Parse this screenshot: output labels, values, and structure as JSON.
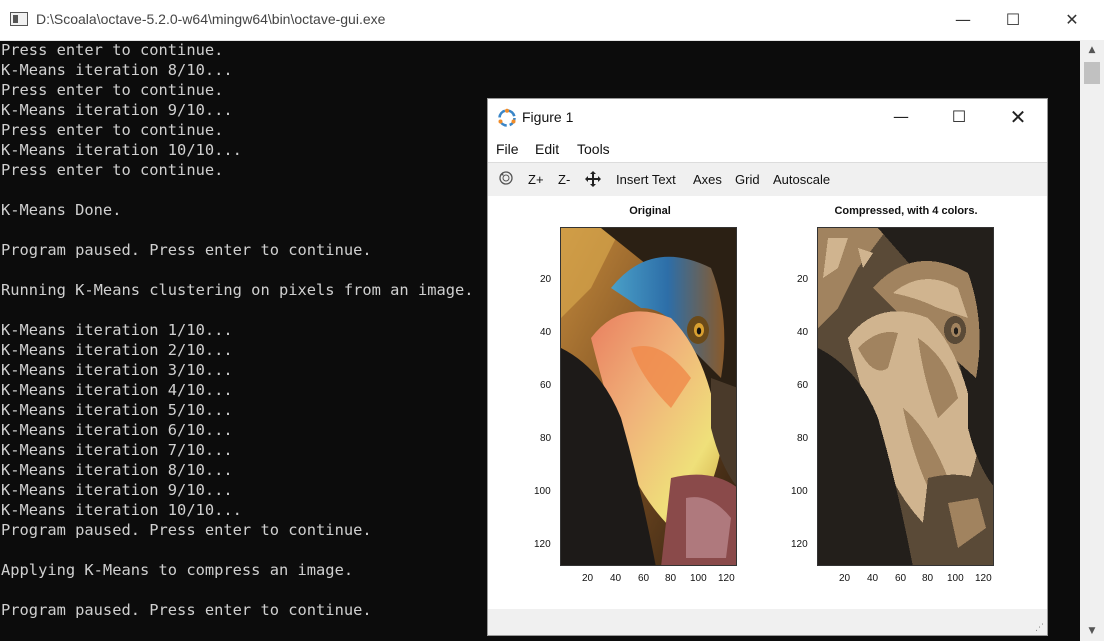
{
  "console": {
    "title": "D:\\Scoala\\octave-5.2.0-w64\\mingw64\\bin\\octave-gui.exe",
    "lines": [
      "Press enter to continue.",
      "K-Means iteration 8/10...",
      "Press enter to continue.",
      "K-Means iteration 9/10...",
      "Press enter to continue.",
      "K-Means iteration 10/10...",
      "Press enter to continue.",
      "",
      "K-Means Done.",
      "",
      "Program paused. Press enter to continue.",
      "",
      "Running K-Means clustering on pixels from an image.",
      "",
      "K-Means iteration 1/10...",
      "K-Means iteration 2/10...",
      "K-Means iteration 3/10...",
      "K-Means iteration 4/10...",
      "K-Means iteration 5/10...",
      "K-Means iteration 6/10...",
      "K-Means iteration 7/10...",
      "K-Means iteration 8/10...",
      "K-Means iteration 9/10...",
      "K-Means iteration 10/10...",
      "Program paused. Press enter to continue.",
      "",
      "Applying K-Means to compress an image.",
      "",
      "Program paused. Press enter to continue."
    ]
  },
  "figure": {
    "title": "Figure 1",
    "menu": [
      "File",
      "Edit",
      "Tools"
    ],
    "toolbar": {
      "zoom_in": "Z+",
      "zoom_out": "Z-",
      "insert_text": "Insert Text",
      "axes": "Axes",
      "grid": "Grid",
      "autoscale": "Autoscale"
    },
    "icons": {
      "rotate": "rotate-icon",
      "pan": "pan-icon",
      "logo": "octave-logo-icon"
    }
  },
  "chart_data": [
    {
      "type": "image",
      "title": "Original",
      "xticks": [
        20,
        40,
        60,
        80,
        100,
        120
      ],
      "yticks": [
        20,
        40,
        60,
        80,
        100,
        120
      ],
      "xlim": [
        0.5,
        128.5
      ],
      "ylim": [
        0.5,
        128.5
      ]
    },
    {
      "type": "image",
      "title": "Compressed, with 4 colors.",
      "xticks": [
        20,
        40,
        60,
        80,
        100,
        120
      ],
      "yticks": [
        20,
        40,
        60,
        80,
        100,
        120
      ],
      "xlim": [
        0.5,
        128.5
      ],
      "ylim": [
        0.5,
        128.5
      ],
      "palette": [
        "#231f1b",
        "#5a4a37",
        "#a1835f",
        "#d0b48f"
      ]
    }
  ]
}
